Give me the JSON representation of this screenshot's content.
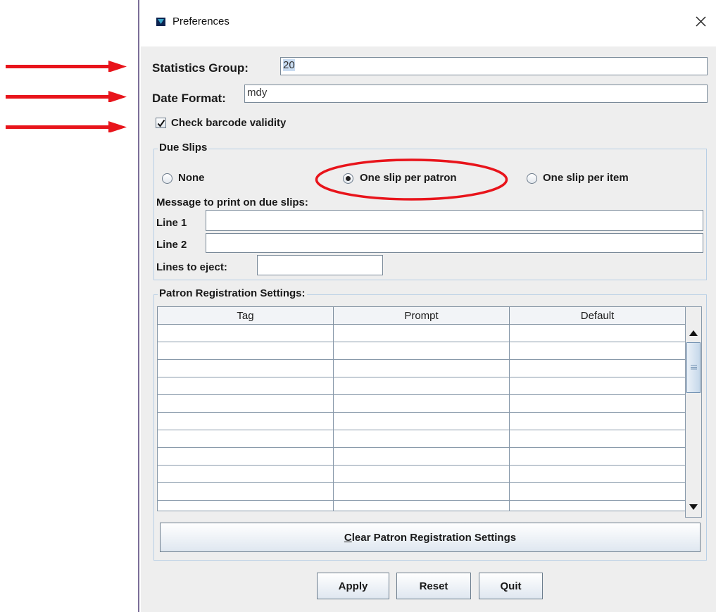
{
  "window": {
    "title": "Preferences"
  },
  "stats": {
    "label": "Statistics Group:",
    "value": "20"
  },
  "date": {
    "label": "Date Format:",
    "value": "mdy"
  },
  "barcode": {
    "label": "Check barcode validity",
    "checked": true
  },
  "due_slips": {
    "legend": "Due Slips",
    "options": [
      "None",
      "One slip per patron",
      "One slip per item"
    ],
    "selected": "One slip per patron",
    "message_label": "Message to print on due slips:",
    "line1_label": "Line 1",
    "line1_value": "",
    "line2_label": "Line 2",
    "line2_value": "",
    "eject_label": "Lines to eject:",
    "eject_value": ""
  },
  "patron": {
    "legend": "Patron Registration Settings:",
    "columns": [
      "Tag",
      "Prompt",
      "Default"
    ],
    "clear_button_rest": "lear Patron Registration Settings",
    "clear_button_mnemonic": "C",
    "clear_button_label": "Clear Patron Registration Settings"
  },
  "buttons": {
    "apply": "Apply",
    "reset": "Reset",
    "quit": "Quit"
  },
  "colors": {
    "annotation": "#e8141b",
    "group_border": "#b8cfe5",
    "client_bg": "#eeeeee"
  },
  "icons": {
    "app": "java-app-icon",
    "close": "close-icon",
    "check": "checkmark-icon",
    "scroll_up": "arrow-up-icon",
    "scroll_down": "arrow-down-icon",
    "grip": "scroll-grip-icon"
  }
}
